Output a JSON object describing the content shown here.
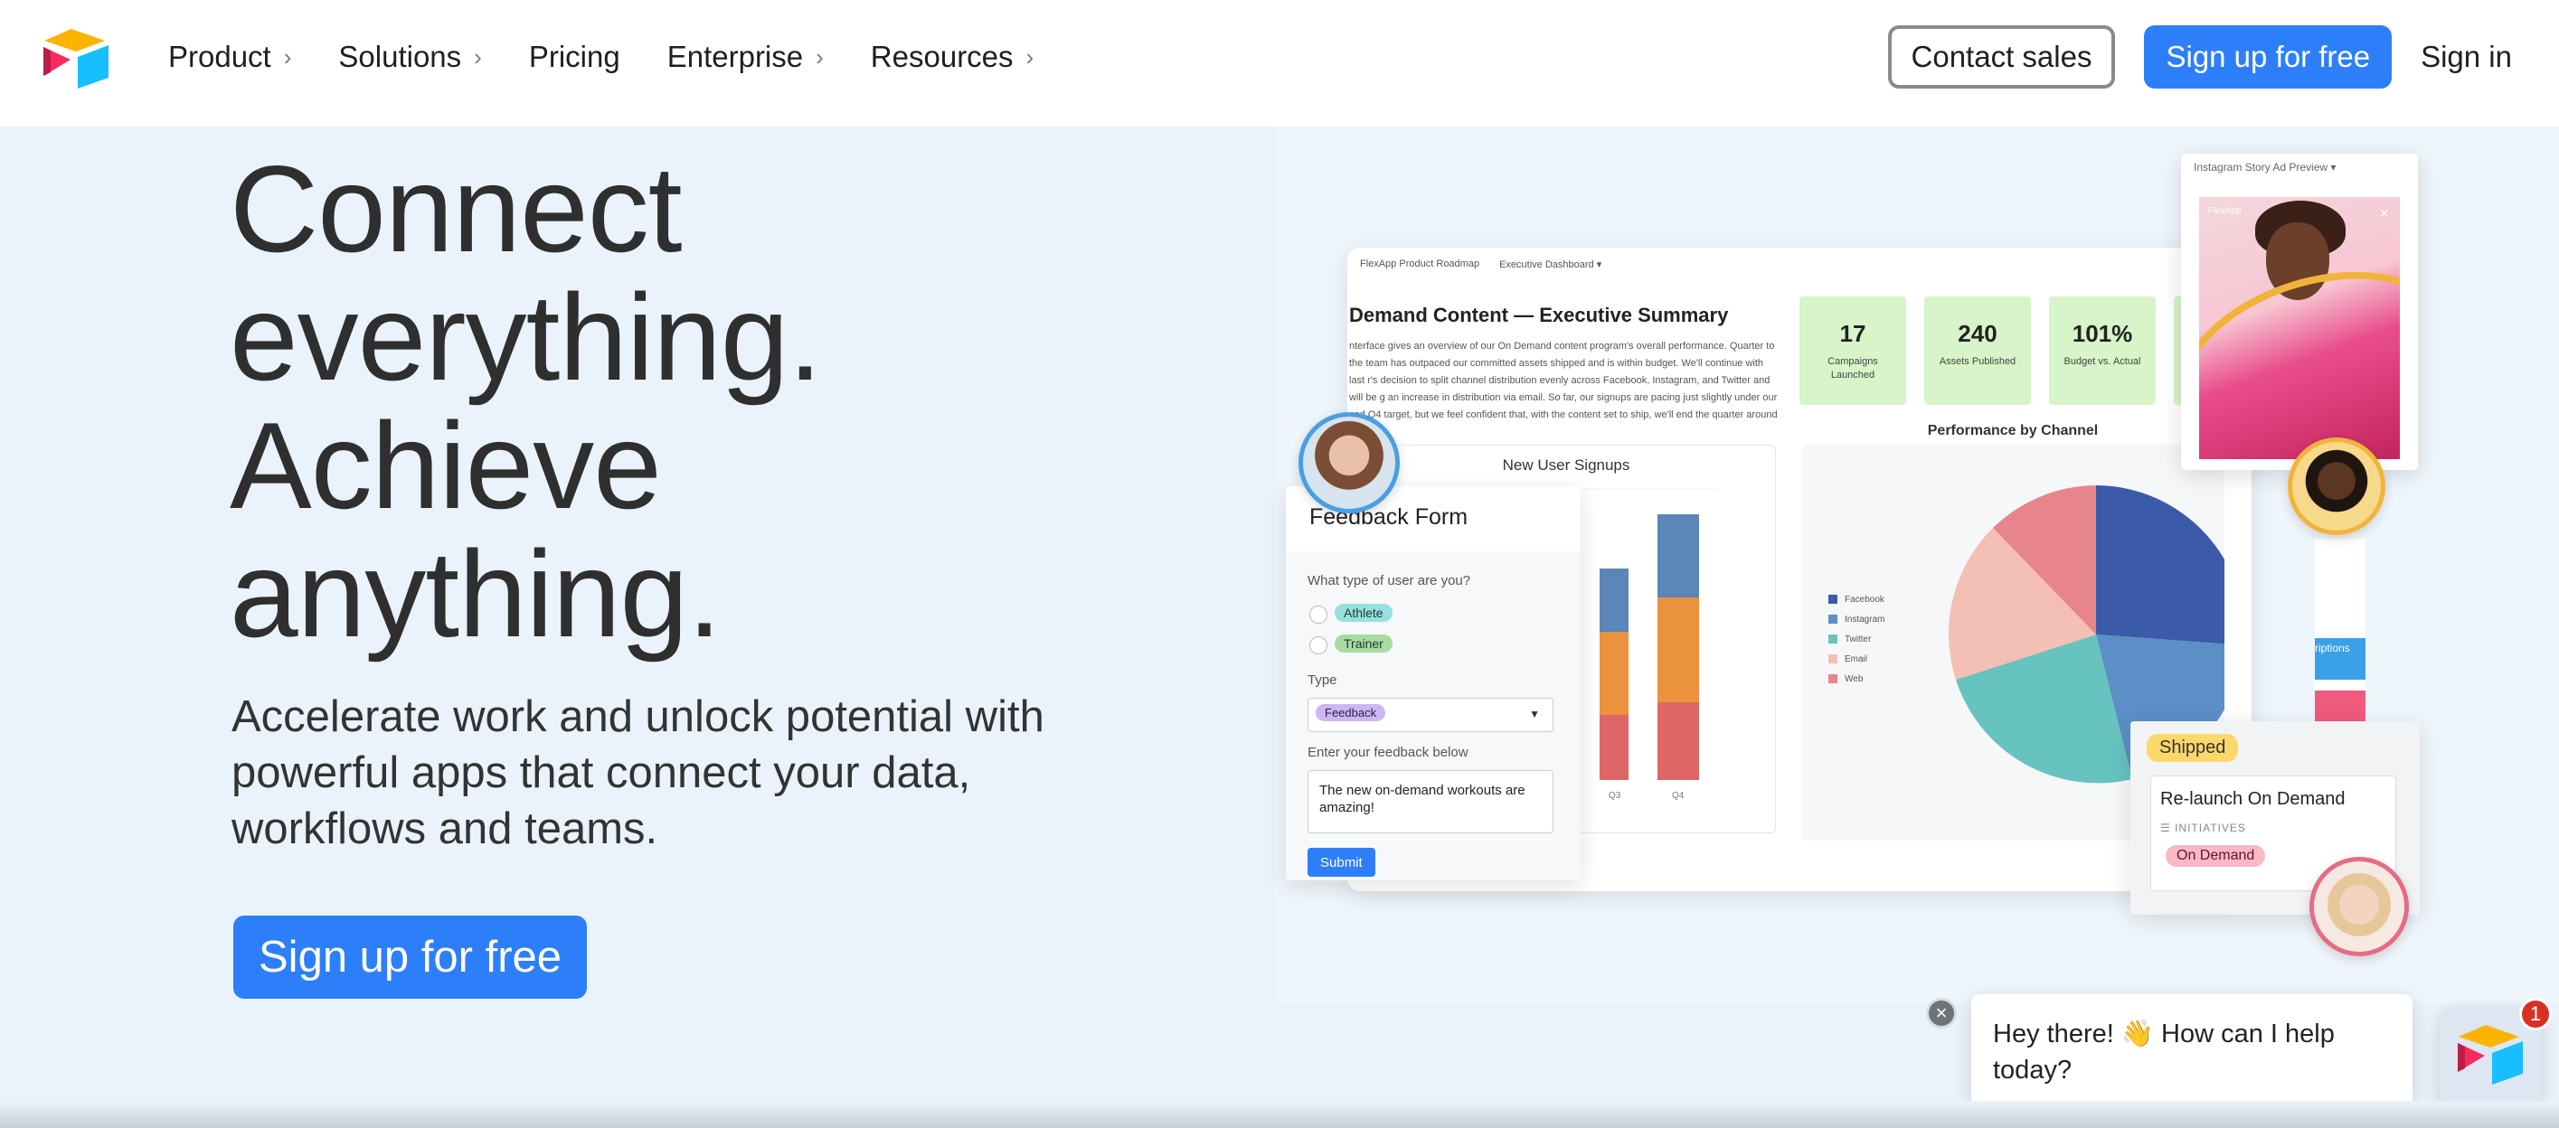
{
  "nav": {
    "links": [
      {
        "label": "Product",
        "has_chevron": true
      },
      {
        "label": "Solutions",
        "has_chevron": true
      },
      {
        "label": "Pricing",
        "has_chevron": false
      },
      {
        "label": "Enterprise",
        "has_chevron": true
      },
      {
        "label": "Resources",
        "has_chevron": true
      }
    ],
    "contact_sales": "Contact sales",
    "signup": "Sign up for free",
    "signin": "Sign in"
  },
  "hero": {
    "title_lines": [
      "Connect",
      "everything.",
      "Achieve",
      "anything."
    ],
    "subtitle": "Accelerate work and unlock potential with powerful apps that connect your data, workflows and teams.",
    "cta": "Sign up for free"
  },
  "dashboard": {
    "tabs": [
      "FlexApp Product Roadmap",
      "Executive Dashboard ▾"
    ],
    "title": "Demand Content — Executive Summary",
    "description": "nterface gives an overview of our On Demand content program's overall performance. Quarter to the team has outpaced our committed assets shipped and is within budget. We'll continue with last r's decision to split channel distribution evenly across Facebook, Instagram, and Twitter and will be g an increase in distribution via email. So far, our signups are pacing just slightly under our sed Q4 target, but we feel confident that, with the content set to ship, we'll end the quarter around t goal.",
    "kpis": [
      {
        "value": "17",
        "label": "Campaigns Launched"
      },
      {
        "value": "240",
        "label": "Assets Published"
      },
      {
        "value": "101%",
        "label": "Budget vs. Actual"
      }
    ],
    "signups_title": "New User Signups",
    "signups_xlabels": [
      "Q3",
      "Q4"
    ],
    "performance_title": "Performance by Channel",
    "channels": [
      "Facebook",
      "Instagram",
      "Twitter",
      "Email",
      "Web"
    ],
    "channel_colors": [
      "#3b5aa9",
      "#5b8fc5",
      "#66c3c0",
      "#f4bfb4",
      "#e8848c"
    ]
  },
  "form": {
    "title": "Feedback Form",
    "q1": "What type of user are you?",
    "options": [
      "Athlete",
      "Trainer"
    ],
    "type_label": "Type",
    "type_value": "Feedback",
    "feedback_label": "Enter your feedback below",
    "feedback_value": "The new on-demand workouts are amazing!",
    "submit": "Submit"
  },
  "instagram": {
    "header": "Instagram Story Ad Preview ▾",
    "brand": "FlexApp"
  },
  "side_bar_label": "riptions",
  "shipped": {
    "badge": "Shipped",
    "title": "Re-launch On Demand",
    "field": "INITIATIVES",
    "tag": "On Demand"
  },
  "chat": {
    "message": "Hey there! 👋 How can I help today?",
    "badge_count": "1"
  }
}
